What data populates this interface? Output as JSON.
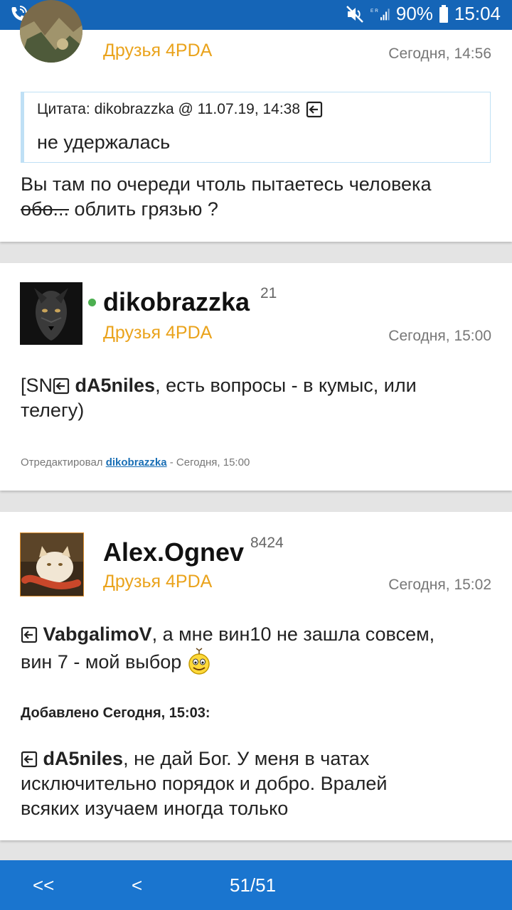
{
  "status_bar": {
    "battery": "90%",
    "time": "15:04"
  },
  "posts": [
    {
      "group": "Друзья 4PDA",
      "time": "Сегодня, 14:56",
      "quote_header": "Цитата: dikobrazzka @ 11.07.19, 14:38",
      "quote_text": "не удержалась",
      "text_line1": "Вы там по очереди чтоль пытаетесь человека",
      "text_strike": "обо...",
      "text_line2_rest": " облить грязью ?"
    },
    {
      "nick": "dikobrazzka",
      "rep": "21",
      "group": "Друзья 4PDA",
      "time": "Сегодня, 15:00",
      "text_prefix": "[SN",
      "mention": "dA5niles",
      "text_rest": ", есть вопросы - в кумыс, или",
      "text_line2": "телегу)",
      "edited_prefix": "Отредактировал ",
      "edited_by": "dikobrazzka",
      "edited_suffix": " - Сегодня, 15:00"
    },
    {
      "nick": "Alex.Ognev",
      "rep": "8424",
      "group": "Друзья 4PDA",
      "time": "Сегодня, 15:02",
      "mention1": "VabgalimoV",
      "text1_rest": ", а мне вин10 не зашла совсем,",
      "text1_line2": "вин 7 - мой выбор",
      "added_label": "Добавлено Сегодня, 15:03:",
      "mention2": "dA5niles",
      "text2_rest": ", не дай Бог. У меня в чатах",
      "text2_line2": "исключительно порядок и добро. Вралей",
      "text2_line3": "всяких изучаем иногда только"
    }
  ],
  "pagination": {
    "first": "<<",
    "prev": "<",
    "page": "51/51"
  },
  "colors": {
    "status_bar": "#1565b7",
    "bottom_bar": "#1a75cf",
    "group": "#eaa31c",
    "quote_border": "#bfe0f5"
  }
}
